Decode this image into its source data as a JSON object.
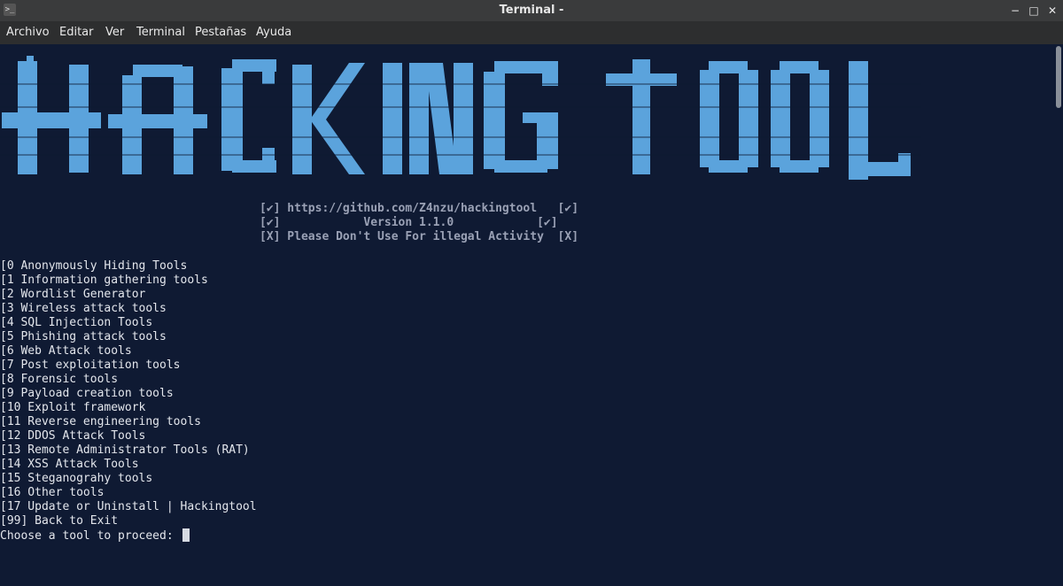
{
  "window": {
    "title": "Terminal -",
    "app_icon": ">_"
  },
  "window_controls": {
    "minimize": "−",
    "maximize": "□",
    "close": "✕"
  },
  "menu": [
    "Archivo",
    "Editar",
    "Ver",
    "Terminal",
    "Pestañas",
    "Ayuda"
  ],
  "banner": {
    "text": "HACKING TOOL",
    "color": "#5ba3dc",
    "background": "#0f1a33"
  },
  "info_lines": [
    "[✔] https://github.com/Z4nzu/hackingtool   [✔]",
    "[✔]            Version 1.1.0            [✔]",
    "[X] Please Don't Use For illegal Activity  [X]"
  ],
  "menu_items": [
    "[0 Anonymously Hiding Tools",
    "[1 Information gathering tools",
    "[2 Wordlist Generator",
    "[3 Wireless attack tools",
    "[4 SQL Injection Tools",
    "[5 Phishing attack tools",
    "[6 Web Attack tools",
    "[7 Post exploitation tools",
    "[8 Forensic tools",
    "[9 Payload creation tools",
    "[10 Exploit framework",
    "[11 Reverse engineering tools",
    "[12 DDOS Attack Tools",
    "[13 Remote Administrator Tools (RAT)",
    "[14 XSS Attack Tools",
    "[15 Steganograhy tools",
    "[16 Other tools",
    "[17 Update or Uninstall | Hackingtool",
    "[99] Back to Exit"
  ],
  "prompt": "Choose a tool to proceed: "
}
